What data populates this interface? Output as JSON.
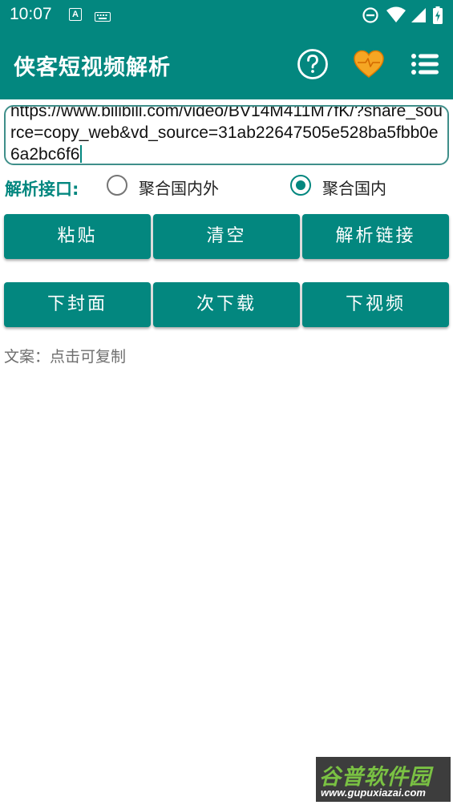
{
  "status_bar": {
    "time": "10:07",
    "notification_badge": "A"
  },
  "toolbar": {
    "title": "侠客短视频解析",
    "icons": [
      "help-icon",
      "heart-icon",
      "menu-list-icon"
    ]
  },
  "url_input": {
    "value": "https://www.bilibili.com/video/BV14M411M7fK/?share_source=copy_web&vd_source=31ab22647505e528ba5fbb0e6a2bc6f6"
  },
  "interface": {
    "label": "解析接口:",
    "options": [
      {
        "label": "聚合国内外",
        "checked": false
      },
      {
        "label": "聚合国内",
        "checked": true
      }
    ]
  },
  "buttons_row1": {
    "paste": "粘贴",
    "clear": "清空",
    "parse": "解析链接"
  },
  "buttons_row2": {
    "cover": "下封面",
    "download": "次下载",
    "video": "下视频"
  },
  "copy_hint": "文案：点击可复制",
  "watermark": {
    "top": "谷普软件园",
    "bottom": "www.gupuxiazai.com"
  },
  "colors": {
    "primary": "#03877f",
    "heart": "#f5a623"
  }
}
